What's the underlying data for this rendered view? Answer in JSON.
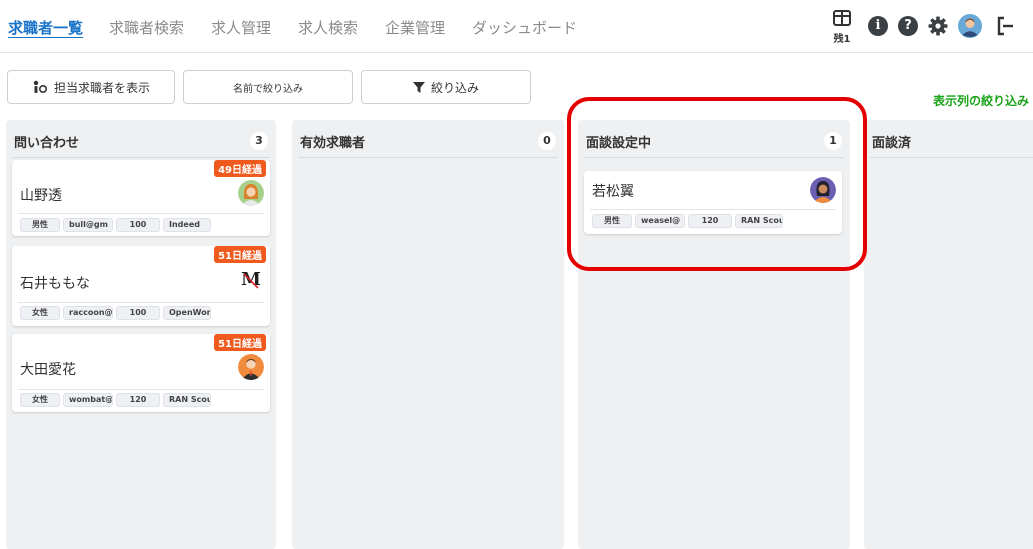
{
  "nav": {
    "items": [
      "求職者一覧",
      "求職者検索",
      "求人管理",
      "求人検索",
      "企業管理",
      "ダッシュボード"
    ],
    "remaining_label": "残1"
  },
  "toolbar": {
    "show_assigned_label": "担当求職者を表示",
    "name_filter_label": "名前で絞り込み",
    "filter_label": "絞り込み",
    "column_filter_label": "表示列の絞り込み"
  },
  "columns": [
    {
      "title": "問い合わせ",
      "count": "3"
    },
    {
      "title": "有効求職者",
      "count": "0"
    },
    {
      "title": "面談設定中",
      "count": "1"
    },
    {
      "title": "面談済",
      "count": ""
    }
  ],
  "cards": {
    "c1": {
      "badge": "49日経過",
      "name": "山野透",
      "tags": [
        "男性",
        "bull@gm",
        "100",
        "Indeed"
      ],
      "avatar": "woman-avatar"
    },
    "c2": {
      "badge": "51日経過",
      "name": "石井ももな",
      "tags": [
        "女性",
        "raccoon@",
        "100",
        "OpenWor"
      ],
      "avatar": "m-logo-avatar",
      "logo_text": "M"
    },
    "c3": {
      "badge": "51日経過",
      "name": "大田愛花",
      "tags": [
        "女性",
        "wombat@",
        "120",
        "RAN Scou"
      ],
      "avatar": "man-orange-avatar"
    },
    "c4": {
      "name": "若松翼",
      "tags": [
        "男性",
        "weasel@",
        "120",
        "RAN Scou"
      ],
      "avatar": "woman-purple-avatar"
    }
  },
  "colors": {
    "accent": "#1a73c9",
    "badge": "#f05a1e",
    "highlight": "#e50000",
    "filter_link": "#1aa31a"
  }
}
